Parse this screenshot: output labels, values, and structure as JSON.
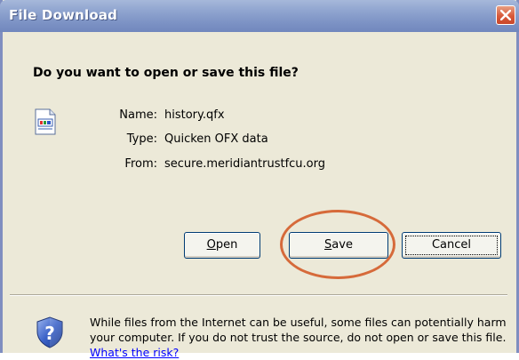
{
  "window": {
    "title": "File Download"
  },
  "question": "Do you want to open or save this file?",
  "file": {
    "icon": "qfx-file-icon",
    "fields": [
      {
        "label": "Name:",
        "value": "history.qfx"
      },
      {
        "label": "Type:",
        "value": "Quicken OFX data"
      },
      {
        "label": "From:",
        "value": "secure.meridiantrustfcu.org"
      }
    ]
  },
  "buttons": {
    "open": {
      "mnemonic": "O",
      "rest": "pen"
    },
    "save": {
      "mnemonic": "S",
      "rest": "ave"
    },
    "cancel": "Cancel"
  },
  "annotation": {
    "color": "#d66a3a",
    "target": "save-button"
  },
  "warning": {
    "icon": "shield-question-icon",
    "text": "While files from the Internet can be useful, some files can potentially harm your computer. If you do not trust the source, do not open or save this file.",
    "link": "What's the risk?"
  },
  "colors": {
    "titlebar": "#8fa4cf",
    "dialog_bg": "#ece9d8",
    "link": "#0000ff",
    "close_button": "#d8593a"
  }
}
